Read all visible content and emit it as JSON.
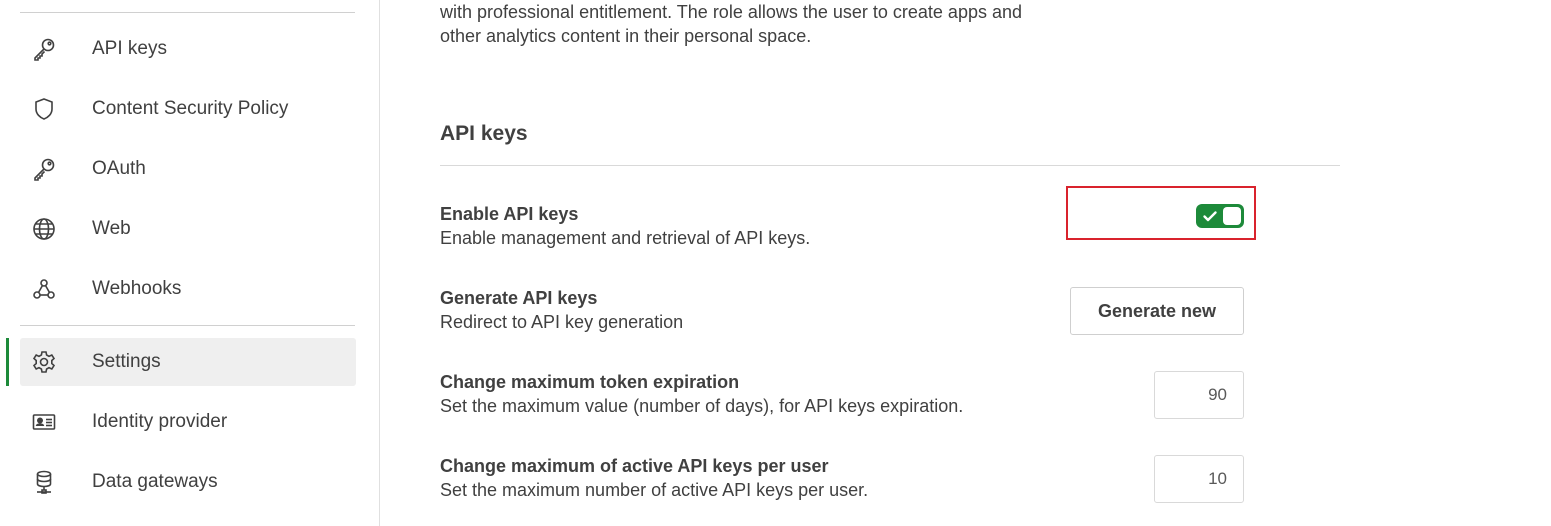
{
  "sidebar": {
    "items": [
      {
        "label": "API keys",
        "icon": "key-icon"
      },
      {
        "label": "Content Security Policy",
        "icon": "shield-icon"
      },
      {
        "label": "OAuth",
        "icon": "key-icon"
      },
      {
        "label": "Web",
        "icon": "globe-icon"
      },
      {
        "label": "Webhooks",
        "icon": "webhook-icon"
      },
      {
        "label": "Settings",
        "icon": "gear-icon",
        "active": true
      },
      {
        "label": "Identity provider",
        "icon": "id-card-icon"
      },
      {
        "label": "Data gateways",
        "icon": "database-icon"
      }
    ],
    "accent_color": "#1d8a3a"
  },
  "main": {
    "intro_line1": "with professional entitlement. The role allows the user to create apps and",
    "intro_line2": "other analytics content in their personal space.",
    "section_title": "API keys",
    "settings": {
      "enable": {
        "title": "Enable API keys",
        "description": "Enable management and retrieval of API keys.",
        "enabled": true
      },
      "generate": {
        "title": "Generate API keys",
        "description": "Redirect to API key generation",
        "button_label": "Generate new"
      },
      "expiration": {
        "title": "Change maximum token expiration",
        "description": "Set the maximum value (number of days), for API keys expiration.",
        "value": "90"
      },
      "max_keys": {
        "title": "Change maximum of active API keys per user",
        "description": "Set the maximum number of active API keys per user.",
        "value": "10"
      }
    },
    "highlight_color": "#d9232d"
  }
}
